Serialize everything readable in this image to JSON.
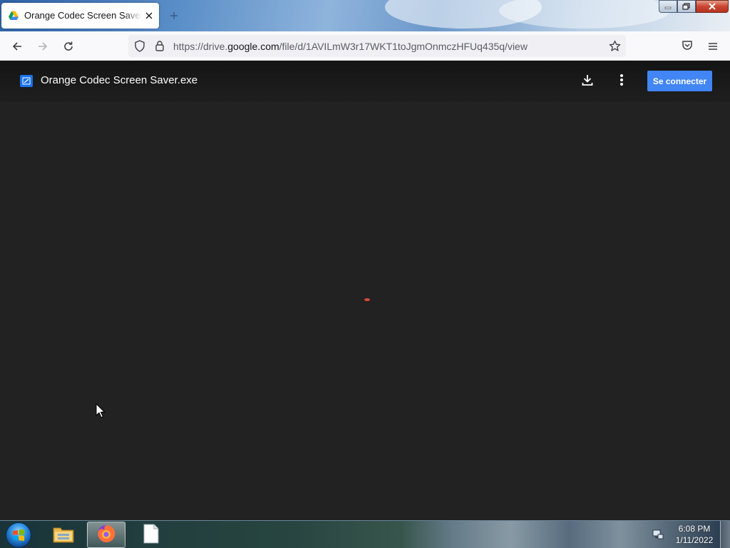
{
  "browser": {
    "tab": {
      "title": "Orange Codec Screen Saver.exe",
      "favicon": "google-drive-icon"
    },
    "url": {
      "prefix": "https://drive.",
      "host": "google.com",
      "path": "/file/d/1AVILmW3r17WKT1toJgmOnmczHFUq435q/view"
    }
  },
  "viewer": {
    "file_name": "Orange Codec Screen Saver.exe",
    "sign_in_label": "Se connecter",
    "header_icons": [
      "download-icon",
      "more-vert-icon"
    ],
    "loading_spinner_color": "#d94b3c"
  },
  "taskbar": {
    "pinned": [
      "file-explorer-icon",
      "firefox-icon",
      "document-icon"
    ],
    "clock": {
      "time": "6:08 PM",
      "date": "1/11/2022"
    }
  },
  "colors": {
    "signin_button": "#4285f4",
    "viewer_background": "#222222",
    "toolbar_background": "#f9f9fb"
  }
}
